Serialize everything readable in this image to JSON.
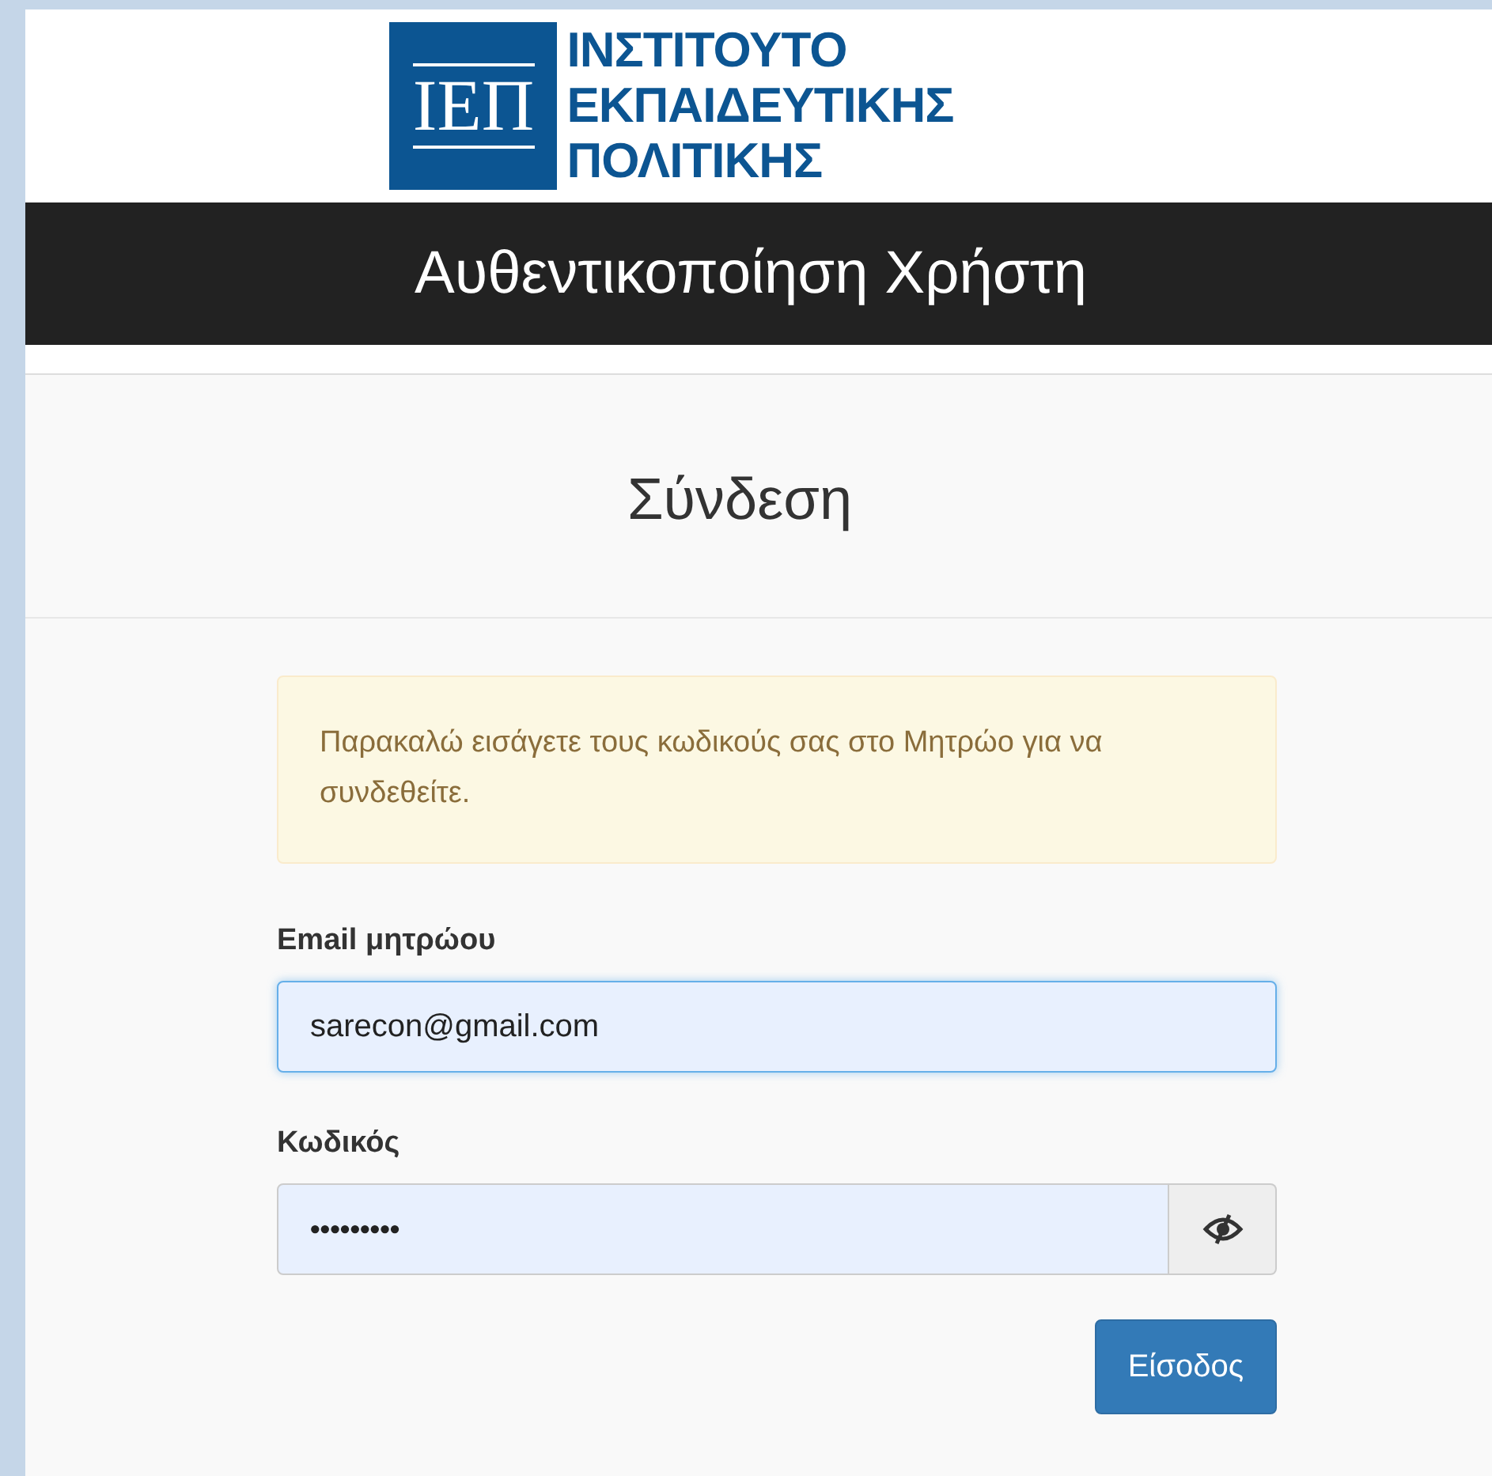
{
  "logo": {
    "mark": "ΙΕΠ",
    "lines": [
      "ΙΝΣΤΙΤΟΥΤΟ",
      "ΕΚΠΑΙΔΕΥΤΙΚΗΣ",
      "ΠΟΛΙΤΙΚΗΣ"
    ]
  },
  "header": {
    "title": "Αυθεντικοποίηση Χρήστη"
  },
  "panel": {
    "heading": "Σύνδεση",
    "alert": "Παρακαλώ εισάγετε τους κωδικούς σας στο Μητρώο για να συνδεθείτε.",
    "fields": [
      {
        "kind": "text",
        "label": "Email μητρώου",
        "value": "sarecon@gmail.com",
        "focused": true
      },
      {
        "kind": "password",
        "label": "Κωδικός",
        "value": "•••••••••",
        "focused": false
      }
    ],
    "submit": "Είσοδος"
  }
}
